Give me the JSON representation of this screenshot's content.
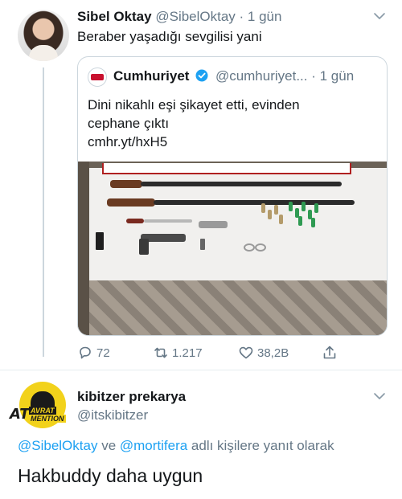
{
  "tweet": {
    "author_name": "Sibel Oktay",
    "author_handle": "@SibelOktay",
    "separator": " · ",
    "time": "1 gün",
    "text": "Beraber yaşadığı sevgilisi yani",
    "quoted": {
      "author_name": "Cumhuriyet",
      "author_handle": "@cumhuriyet...",
      "separator": " · ",
      "time": "1 gün",
      "text_lines": [
        "Dini nikahlı eşi şikayet etti, evinden",
        "cephane çıktı",
        "cmhr.yt/hxH5"
      ],
      "avatar_text": "Cumhuriyet"
    },
    "actions": {
      "replies": "72",
      "retweets": "1.217",
      "likes": "38,2B"
    }
  },
  "reply": {
    "author_name": "kibitzer prekarya",
    "author_handle": "@itskibitzer",
    "avatar_logo": [
      "AT",
      "AVRAT",
      "MENTION"
    ],
    "reply_to_prefix": "",
    "mention1": "@SibelOktay",
    "conjunction": " ve ",
    "mention2": "@mortifera",
    "reply_to_suffix": " adlı kişilere yanıt olarak",
    "text": "Hakbuddy daha uygun"
  },
  "colors": {
    "link": "#1da1f2",
    "secondary_text": "#657786",
    "verified": "#1da1f2",
    "divider": "#e6ecf0"
  },
  "icons": [
    "chevron-down-icon",
    "verified-badge-icon",
    "reply-icon",
    "retweet-icon",
    "like-icon",
    "share-icon"
  ]
}
